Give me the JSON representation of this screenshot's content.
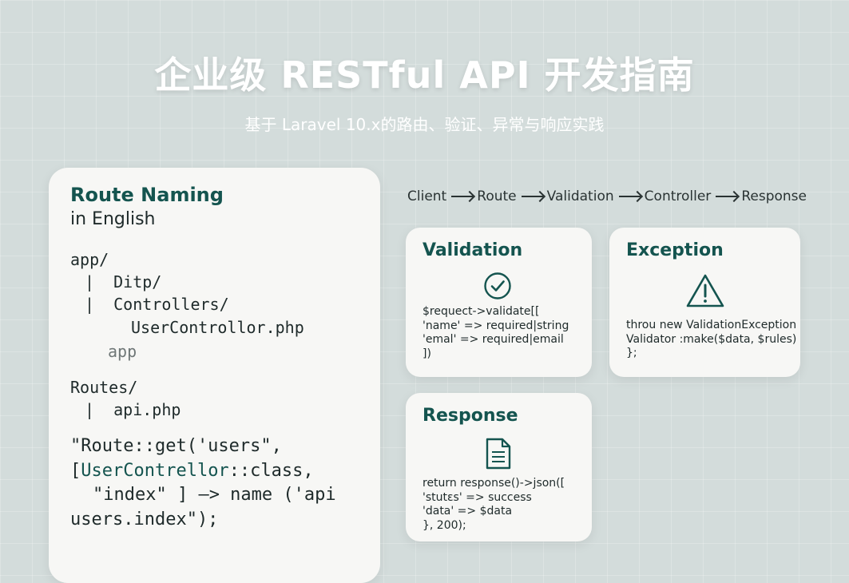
{
  "header": {
    "title": "企业级 RESTful API 开发指南",
    "subtitle": "基于 Laravel 10.x的路由、验证、异常与响应实践"
  },
  "left_panel": {
    "heading": "Route Naming",
    "subheading": "in English",
    "tree": [
      "app/",
      "|  Ditp/",
      "|  Controllers/",
      "UserControllor.php",
      "app",
      "Routes/",
      "|  api.php"
    ],
    "code": {
      "line1": "\"Route::get('users\",",
      "line2_bracket": "[",
      "line2_class": "UserContrellor",
      "line2_rest": "::class,",
      "line3": "\"index\" ] —> name ('api",
      "line4": "users.index\");"
    }
  },
  "flow": {
    "steps": [
      "Client",
      "Route",
      "Validation",
      "Controller",
      "Response"
    ]
  },
  "cards": {
    "validation": {
      "title": "Validation",
      "icon": "check-circle-icon",
      "code": [
        "$requect->validate[[",
        "'name' => required|string",
        "'emal' => required|email",
        "])"
      ]
    },
    "exception": {
      "title": "Exception",
      "icon": "warning-icon",
      "code": [
        "throu new ValidationException",
        "Validator :make($data, $rules)",
        "};"
      ]
    },
    "response": {
      "title": "Response",
      "icon": "document-icon",
      "code": [
        "return response()->json([",
        "'stutεs' => success",
        "'data' => $data",
        "}, 200);"
      ]
    }
  },
  "colors": {
    "accent": "#14544f",
    "background": "#d3dcdb",
    "card": "#f7f7f5",
    "text": "#1e2a2a"
  }
}
